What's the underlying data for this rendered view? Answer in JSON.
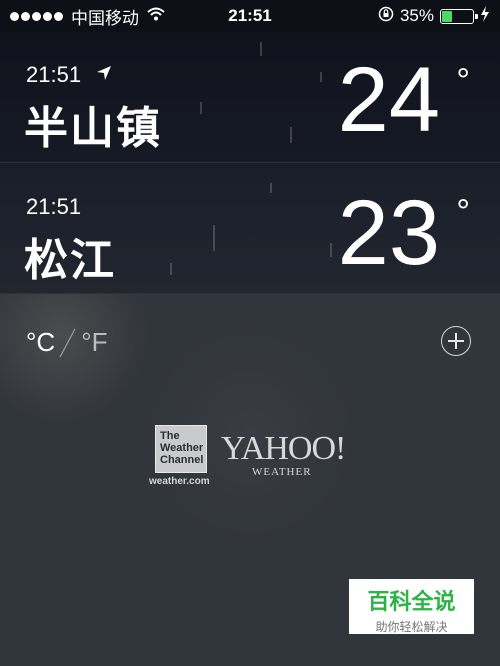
{
  "status_bar": {
    "carrier": "中国移动",
    "time": "21:51",
    "battery_percent": "35%",
    "battery_level": 0.35,
    "signal_bars": 5,
    "icons": [
      "signal-dots-icon",
      "wifi-icon",
      "rotation-lock-icon",
      "battery-icon",
      "charging-bolt-icon"
    ]
  },
  "cities": [
    {
      "time": "21:51",
      "name": "半山镇",
      "temperature": "24",
      "degree_symbol": "°",
      "current_location": true
    },
    {
      "time": "21:51",
      "name": "松江",
      "temperature": "23",
      "degree_symbol": "°",
      "current_location": false
    }
  ],
  "units": {
    "celsius": "°C",
    "fahrenheit": "°F",
    "selected": "celsius"
  },
  "providers": {
    "twc_lines": [
      "The",
      "Weather",
      "Channel"
    ],
    "twc_url": "weather.com",
    "yahoo": "YAHOO!",
    "yahoo_sub": "WEATHER"
  },
  "watermark": {
    "title": "百科全说",
    "subtitle": "助你轻松解决"
  },
  "colors": {
    "battery_green": "#4cd964",
    "watermark_green": "#2cb345"
  }
}
